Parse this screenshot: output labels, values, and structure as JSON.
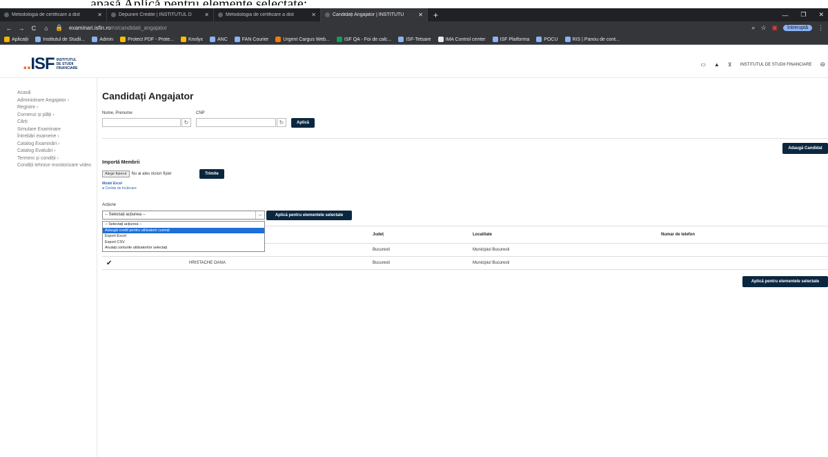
{
  "caption": "apasă Aplică pentru elemente selectate;",
  "browser": {
    "tabs": [
      {
        "label": "Metodologia de certificare a dist",
        "active": false
      },
      {
        "label": "Depuneri Credite | INSTITUTUL D",
        "active": false
      },
      {
        "label": "Metodologia de certificare a dist",
        "active": false
      },
      {
        "label": "Candidați Angajator | INSTITUTU",
        "active": true
      }
    ],
    "new_tab": "+",
    "url_host": "examinari.isfin.ro",
    "url_path": "/ro/candidati_angajator",
    "paused_label": "Întreruptă",
    "bookmarks": [
      "Aplicații",
      "Institutul de Studii...",
      "Admin",
      "Protect PDF - Prote...",
      "Knolyx",
      "ANC",
      "FAN Courier",
      "Urgent Cargus Web...",
      "ISF QA - Foi de calc...",
      "ISF-Tetsare",
      "IMA Control center",
      "ISF Platforma",
      "POCU",
      "RIS | Panou de cont..."
    ]
  },
  "header": {
    "logo_mark": "ISF",
    "logo_sub": [
      "INSTITUTUL",
      "DE STUDII",
      "FINANCIARE"
    ],
    "org_name": "INSTITUTUL DE STUDII FINANCIARE"
  },
  "sidebar": {
    "items": [
      "Acasă",
      "Administrare Angajator ›",
      "Registre ›",
      "Comenzi și plăți ›",
      "Cărți",
      "Simulare Examinare",
      "Întrebări examene ›",
      "Catalog Examinări ›",
      "Catalog Evaluări ›",
      "Termeni și condiții ›",
      "Condiții tehnice monitorizare video"
    ]
  },
  "main": {
    "title": "Candidați Angajator",
    "filters": {
      "name_label": "Nume, Prenume",
      "cnp_label": "CNP",
      "apply_label": "Aplică"
    },
    "add_candidate_label": "Adaugă Candidat",
    "import": {
      "title": "Importă Membrii",
      "choose_file": "Alege fișierul",
      "no_file": "Nu ai ales niciun fișier",
      "submit": "Trimite",
      "model_excel": "Model Excel",
      "upload_requirements": "Cerințe de încărcare"
    },
    "action": {
      "label": "Acțiune",
      "selected": "-- Selectați acțiunea --",
      "apply_selected": "Aplică pentru elementele selectate",
      "options": [
        {
          "label": "-- Selectați acțiunea --",
          "highlighted": false
        },
        {
          "label": "Adaugă credit pentru utilizatorii curenți",
          "highlighted": true
        },
        {
          "label": "Export Excel",
          "highlighted": false
        },
        {
          "label": "Export CSV",
          "highlighted": false
        },
        {
          "label": "Anulați conturile utilizatorilor selectați",
          "highlighted": false
        }
      ]
    },
    "table": {
      "headers": {
        "judet": "Județ",
        "localitate": "Localitate",
        "telefon": "Numar de telefon"
      },
      "rows": [
        {
          "name": "",
          "judet": "Bucuresti",
          "localitate": "Municipiul Bucuresti",
          "checked": true
        },
        {
          "name": "HRISTACHE OANA",
          "judet": "Bucuresti",
          "localitate": "Municipiul Bucuresti",
          "checked": true
        }
      ]
    },
    "apply_bottom_label": "Aplică pentru elementele selectate"
  }
}
